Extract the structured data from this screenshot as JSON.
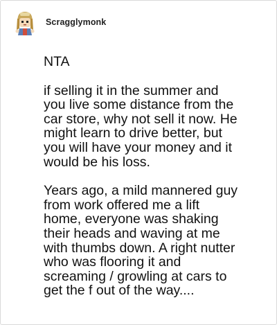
{
  "post": {
    "username": "Scragglymonk",
    "paragraphs": [
      "NTA",
      "if selling it in the summer and\nyou live some distance from the\ncar store, why not sell it now. He\nmight learn to drive better, but\nyou will have your money and it\nwould be his loss.",
      "Years ago, a mild mannered guy\nfrom work offered me a lift\nhome, everyone was shaking\ntheir heads and waving at me\nwith thumbs down. A right nutter\nwho was flooring it and\nscreaming / growling at cars to\nget the f out of the way...."
    ]
  },
  "icons": {
    "avatar": "user-avatar-icon"
  }
}
